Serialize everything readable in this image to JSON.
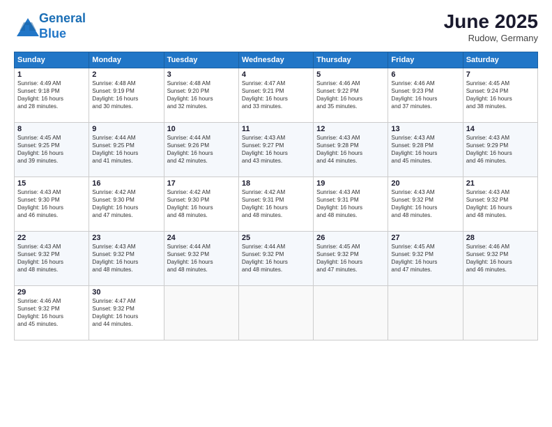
{
  "app": {
    "logo_line1": "General",
    "logo_line2": "Blue"
  },
  "title": "June 2025",
  "subtitle": "Rudow, Germany",
  "days_of_week": [
    "Sunday",
    "Monday",
    "Tuesday",
    "Wednesday",
    "Thursday",
    "Friday",
    "Saturday"
  ],
  "weeks": [
    [
      {
        "day": 1,
        "info": "Sunrise: 4:49 AM\nSunset: 9:18 PM\nDaylight: 16 hours\nand 28 minutes."
      },
      {
        "day": 2,
        "info": "Sunrise: 4:48 AM\nSunset: 9:19 PM\nDaylight: 16 hours\nand 30 minutes."
      },
      {
        "day": 3,
        "info": "Sunrise: 4:48 AM\nSunset: 9:20 PM\nDaylight: 16 hours\nand 32 minutes."
      },
      {
        "day": 4,
        "info": "Sunrise: 4:47 AM\nSunset: 9:21 PM\nDaylight: 16 hours\nand 33 minutes."
      },
      {
        "day": 5,
        "info": "Sunrise: 4:46 AM\nSunset: 9:22 PM\nDaylight: 16 hours\nand 35 minutes."
      },
      {
        "day": 6,
        "info": "Sunrise: 4:46 AM\nSunset: 9:23 PM\nDaylight: 16 hours\nand 37 minutes."
      },
      {
        "day": 7,
        "info": "Sunrise: 4:45 AM\nSunset: 9:24 PM\nDaylight: 16 hours\nand 38 minutes."
      }
    ],
    [
      {
        "day": 8,
        "info": "Sunrise: 4:45 AM\nSunset: 9:25 PM\nDaylight: 16 hours\nand 39 minutes."
      },
      {
        "day": 9,
        "info": "Sunrise: 4:44 AM\nSunset: 9:25 PM\nDaylight: 16 hours\nand 41 minutes."
      },
      {
        "day": 10,
        "info": "Sunrise: 4:44 AM\nSunset: 9:26 PM\nDaylight: 16 hours\nand 42 minutes."
      },
      {
        "day": 11,
        "info": "Sunrise: 4:43 AM\nSunset: 9:27 PM\nDaylight: 16 hours\nand 43 minutes."
      },
      {
        "day": 12,
        "info": "Sunrise: 4:43 AM\nSunset: 9:28 PM\nDaylight: 16 hours\nand 44 minutes."
      },
      {
        "day": 13,
        "info": "Sunrise: 4:43 AM\nSunset: 9:28 PM\nDaylight: 16 hours\nand 45 minutes."
      },
      {
        "day": 14,
        "info": "Sunrise: 4:43 AM\nSunset: 9:29 PM\nDaylight: 16 hours\nand 46 minutes."
      }
    ],
    [
      {
        "day": 15,
        "info": "Sunrise: 4:43 AM\nSunset: 9:30 PM\nDaylight: 16 hours\nand 46 minutes."
      },
      {
        "day": 16,
        "info": "Sunrise: 4:42 AM\nSunset: 9:30 PM\nDaylight: 16 hours\nand 47 minutes."
      },
      {
        "day": 17,
        "info": "Sunrise: 4:42 AM\nSunset: 9:30 PM\nDaylight: 16 hours\nand 48 minutes."
      },
      {
        "day": 18,
        "info": "Sunrise: 4:42 AM\nSunset: 9:31 PM\nDaylight: 16 hours\nand 48 minutes."
      },
      {
        "day": 19,
        "info": "Sunrise: 4:43 AM\nSunset: 9:31 PM\nDaylight: 16 hours\nand 48 minutes."
      },
      {
        "day": 20,
        "info": "Sunrise: 4:43 AM\nSunset: 9:32 PM\nDaylight: 16 hours\nand 48 minutes."
      },
      {
        "day": 21,
        "info": "Sunrise: 4:43 AM\nSunset: 9:32 PM\nDaylight: 16 hours\nand 48 minutes."
      }
    ],
    [
      {
        "day": 22,
        "info": "Sunrise: 4:43 AM\nSunset: 9:32 PM\nDaylight: 16 hours\nand 48 minutes."
      },
      {
        "day": 23,
        "info": "Sunrise: 4:43 AM\nSunset: 9:32 PM\nDaylight: 16 hours\nand 48 minutes."
      },
      {
        "day": 24,
        "info": "Sunrise: 4:44 AM\nSunset: 9:32 PM\nDaylight: 16 hours\nand 48 minutes."
      },
      {
        "day": 25,
        "info": "Sunrise: 4:44 AM\nSunset: 9:32 PM\nDaylight: 16 hours\nand 48 minutes."
      },
      {
        "day": 26,
        "info": "Sunrise: 4:45 AM\nSunset: 9:32 PM\nDaylight: 16 hours\nand 47 minutes."
      },
      {
        "day": 27,
        "info": "Sunrise: 4:45 AM\nSunset: 9:32 PM\nDaylight: 16 hours\nand 47 minutes."
      },
      {
        "day": 28,
        "info": "Sunrise: 4:46 AM\nSunset: 9:32 PM\nDaylight: 16 hours\nand 46 minutes."
      }
    ],
    [
      {
        "day": 29,
        "info": "Sunrise: 4:46 AM\nSunset: 9:32 PM\nDaylight: 16 hours\nand 45 minutes."
      },
      {
        "day": 30,
        "info": "Sunrise: 4:47 AM\nSunset: 9:32 PM\nDaylight: 16 hours\nand 44 minutes."
      },
      null,
      null,
      null,
      null,
      null
    ]
  ]
}
